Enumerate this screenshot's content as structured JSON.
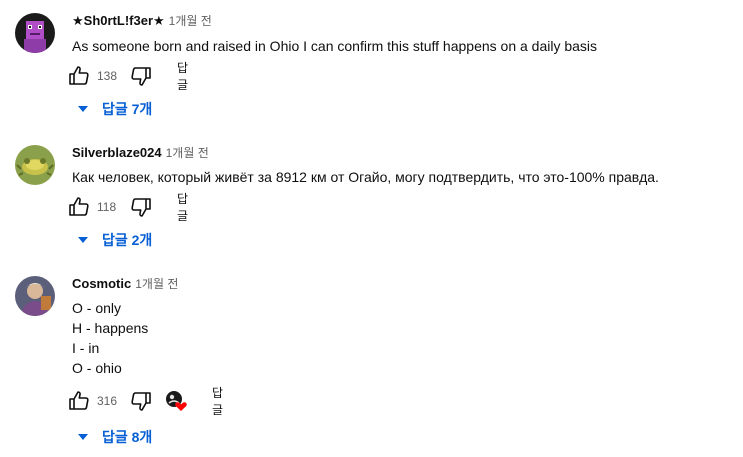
{
  "comments": [
    {
      "author": "★Sh0rtL!f3er★",
      "time": "1개월 전",
      "lines": [
        "As someone born and raised in Ohio I can confirm this stuff happens on a daily basis"
      ],
      "likes": "138",
      "reply_label": "답글",
      "replies_label": "답글 7개"
    },
    {
      "author": "Silverblaze024",
      "time": "1개월 전",
      "lines": [
        "Как человек, который живёт за  8912 км от Огайо, могу подтвердить, что это-100% правда."
      ],
      "likes": "118",
      "reply_label": "답글",
      "replies_label": "답글 2개"
    },
    {
      "author": "Cosmotic",
      "time": "1개월 전",
      "lines": [
        "O - only",
        "H - happens",
        "I - in",
        "O - ohio"
      ],
      "likes": "316",
      "reply_label": "답글",
      "replies_label": "답글 8개"
    }
  ],
  "icons": {
    "like": "thumb-up-icon",
    "dislike": "thumb-down-icon",
    "expand": "caret-down-icon",
    "creator_heart": "creator-heart-icon"
  },
  "colors": {
    "link_blue": "#065fd4",
    "secondary_text": "#606060",
    "heart_red": "#ff0000"
  }
}
